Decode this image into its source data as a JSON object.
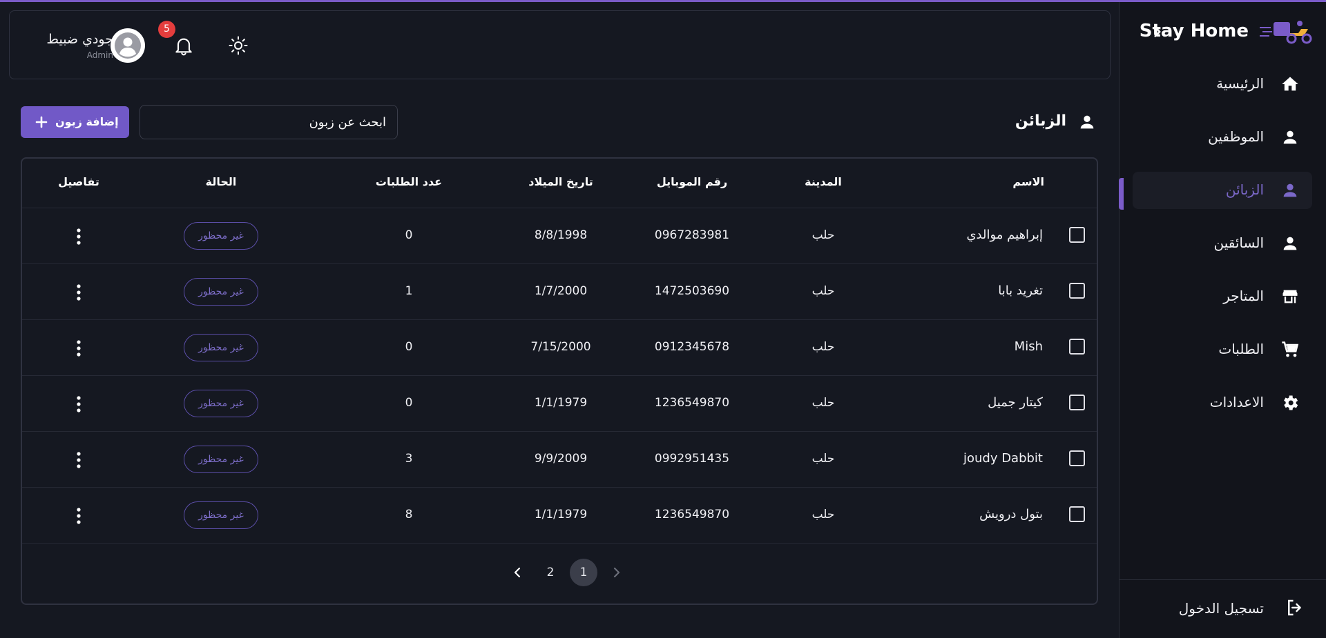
{
  "brand": {
    "title": "Stay Home",
    "logo_icon": "delivery-scooter-logo"
  },
  "sidebar": {
    "items": [
      {
        "label": "الرئيسية",
        "icon": "home-icon",
        "active": false
      },
      {
        "label": "الموظفين",
        "icon": "person-icon",
        "active": false
      },
      {
        "label": "الزبائن",
        "icon": "person-icon",
        "active": true
      },
      {
        "label": "السائقين",
        "icon": "person-icon",
        "active": false
      },
      {
        "label": "المتاجر",
        "icon": "store-icon",
        "active": false
      },
      {
        "label": "الطلبات",
        "icon": "cart-icon",
        "active": false
      },
      {
        "label": "الاعدادات",
        "icon": "gear-icon",
        "active": false
      }
    ],
    "logout_label": "تسجيل الدخول"
  },
  "header": {
    "user_name": "جودي ضبيط",
    "user_role": "Admin",
    "notification_count": "5"
  },
  "page": {
    "title": "الزبائن",
    "search_placeholder": "ابحث عن زبون",
    "add_button_label": "إضافة زبون"
  },
  "table": {
    "headers": {
      "name": "الاسم",
      "city": "المدينة",
      "mobile": "رقم الموبايل",
      "birthdate": "تاريخ الميلاد",
      "orders": "عدد الطلبات",
      "status": "الحالة",
      "details": "تفاصيل"
    },
    "rows": [
      {
        "name": "إبراهيم موالدي",
        "city": "حلب",
        "mobile": "0967283981",
        "birthdate": "8/8/1998",
        "orders": "0",
        "status": "غير محظور"
      },
      {
        "name": "تغريد بابا",
        "city": "حلب",
        "mobile": "1472503690",
        "birthdate": "1/7/2000",
        "orders": "1",
        "status": "غير محظور"
      },
      {
        "name": "Mish",
        "city": "حلب",
        "mobile": "0912345678",
        "birthdate": "7/15/2000",
        "orders": "0",
        "status": "غير محظور"
      },
      {
        "name": "كيتار جميل",
        "city": "حلب",
        "mobile": "1236549870",
        "birthdate": "1/1/1979",
        "orders": "0",
        "status": "غير محظور"
      },
      {
        "name": "joudy Dabbit",
        "city": "حلب",
        "mobile": "0992951435",
        "birthdate": "9/9/2009",
        "orders": "3",
        "status": "غير محظور"
      },
      {
        "name": "بتول درويش",
        "city": "حلب",
        "mobile": "1236549870",
        "birthdate": "1/1/1979",
        "orders": "8",
        "status": "غير محظور"
      }
    ]
  },
  "pagination": {
    "pages": [
      "1",
      "2"
    ],
    "current": "1"
  },
  "colors": {
    "accent": "#7159c7",
    "background": "#151821",
    "sidebar": "#12141b",
    "badge": "#e43d3d"
  }
}
